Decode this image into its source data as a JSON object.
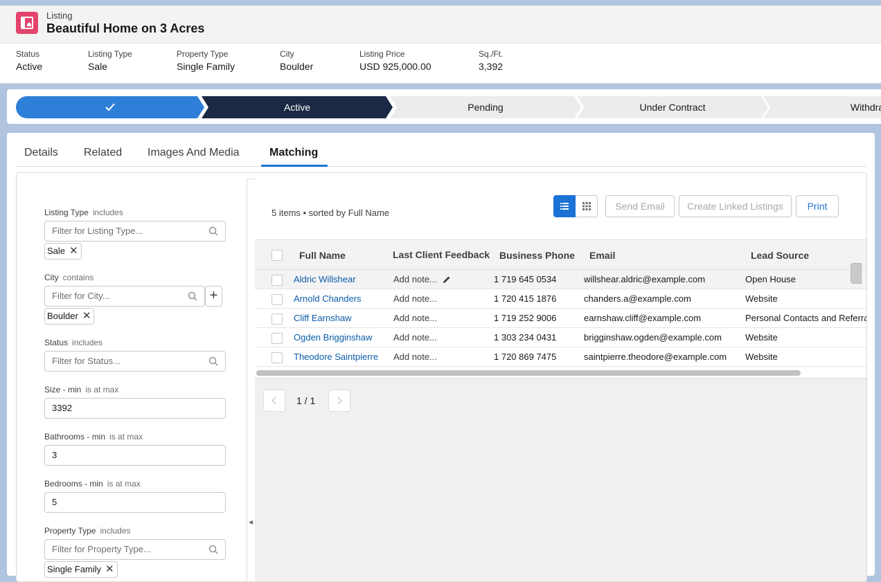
{
  "header": {
    "object_label": "Listing",
    "title": "Beautiful Home on 3 Acres",
    "fields": [
      {
        "label": "Status",
        "value": "Active"
      },
      {
        "label": "Listing Type",
        "value": "Sale"
      },
      {
        "label": "Property Type",
        "value": "Single Family"
      },
      {
        "label": "City",
        "value": "Boulder"
      },
      {
        "label": "Listing Price",
        "value": "USD 925,000.00"
      },
      {
        "label": "Sq./Ft.",
        "value": "3,392"
      }
    ]
  },
  "path": {
    "steps": [
      "Active",
      "Pending",
      "Under Contract",
      "Withdrawn"
    ],
    "completed_icon": "check-icon",
    "current": "Active"
  },
  "tabs": [
    "Details",
    "Related",
    "Images And Media",
    "Matching"
  ],
  "active_tab": "Matching",
  "filters": {
    "listing_type": {
      "label": "Listing Type",
      "op": "includes",
      "placeholder": "Filter for Listing Type...",
      "pill": "Sale"
    },
    "city": {
      "label": "City",
      "op": "contains",
      "placeholder": "Filter for City...",
      "pill": "Boulder"
    },
    "status": {
      "label": "Status",
      "op": "includes",
      "placeholder": "Filter for Status..."
    },
    "size": {
      "label": "Size - min",
      "op": "is at max",
      "value": "3392"
    },
    "bathrooms": {
      "label": "Bathrooms - min",
      "op": "is at max",
      "value": "3"
    },
    "bedrooms": {
      "label": "Bedrooms - min",
      "op": "is at max",
      "value": "5"
    },
    "property_type": {
      "label": "Property Type",
      "op": "includes",
      "placeholder": "Filter for Property Type...",
      "pill": "Single Family"
    }
  },
  "list": {
    "info": "5 items • sorted by Full Name",
    "buttons": {
      "send_email": "Send Email",
      "create_linked": "Create Linked Listings",
      "print": "Print"
    },
    "columns": [
      "Full Name",
      "Last Client Feedback",
      "Business Phone",
      "Email",
      "Lead Source"
    ],
    "rows": [
      {
        "name": "Aldric Willshear",
        "note": "Add note...",
        "phone": "1 719 645 0534",
        "email": "willshear.aldric@example.com",
        "source": "Open House"
      },
      {
        "name": "Arnold Chanders",
        "note": "Add note...",
        "phone": "1 720 415 1876",
        "email": "chanders.a@example.com",
        "source": "Website"
      },
      {
        "name": "Cliff Earnshaw",
        "note": "Add note...",
        "phone": "1 719 252 9006",
        "email": "earnshaw.cliff@example.com",
        "source": "Personal Contacts and Referrals"
      },
      {
        "name": "Ogden Brigginshaw",
        "note": "Add note...",
        "phone": "1 303 234 0431",
        "email": "brigginshaw.ogden@example.com",
        "source": "Website"
      },
      {
        "name": "Theodore Saintpierre",
        "note": "Add note...",
        "phone": "1 720 869 7475",
        "email": "saintpierre.theodore@example.com",
        "source": "Website"
      }
    ],
    "pagination": "1 / 1"
  },
  "colors": {
    "brand_blue": "#1b73d6",
    "path_done": "#2e7fd8",
    "path_current": "#1b2944",
    "icon_pink": "#e3446d"
  }
}
